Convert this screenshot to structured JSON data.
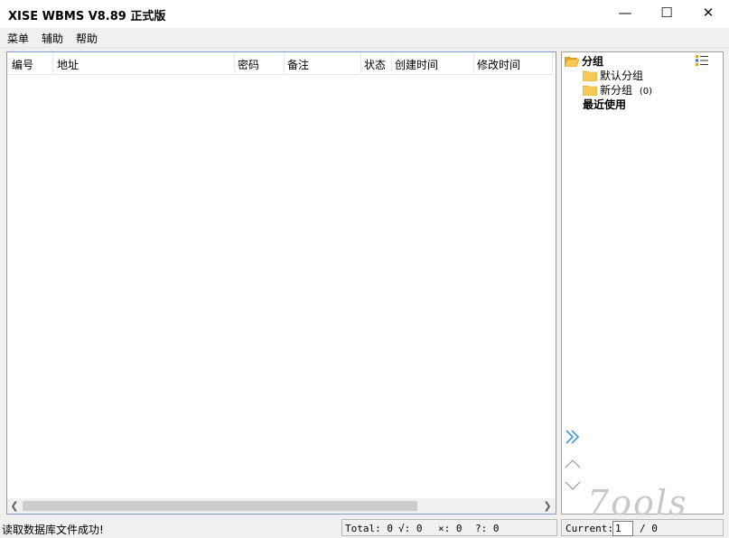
{
  "window": {
    "title": "XISE WBMS V8.89 正式版",
    "minimize": "—",
    "maximize": "☐",
    "close": "✕"
  },
  "menu": {
    "items": [
      "菜单",
      "辅助",
      "帮助"
    ]
  },
  "list": {
    "columns": [
      "编号",
      "地址",
      "密码",
      "备注",
      "状态",
      "创建时间",
      "修改时间"
    ],
    "rows": []
  },
  "tree": {
    "root": "分组",
    "children": [
      {
        "label": "默认分组",
        "count": ""
      },
      {
        "label": "新分组",
        "count": "(0)"
      }
    ],
    "recent": "最近使用"
  },
  "status": {
    "message": "读取数据库文件成功!",
    "total": "Total: 0",
    "ok": "√: 0",
    "fail": "×: 0",
    "unknown": "?: 0",
    "current_label": "Current:",
    "current_value": "1",
    "page_total": "/ 0"
  },
  "watermark": "7ools",
  "colors": {
    "folder": "#f5b731",
    "border_accent": "#7a9ec9",
    "nav_arrow": "#3f95d9"
  }
}
